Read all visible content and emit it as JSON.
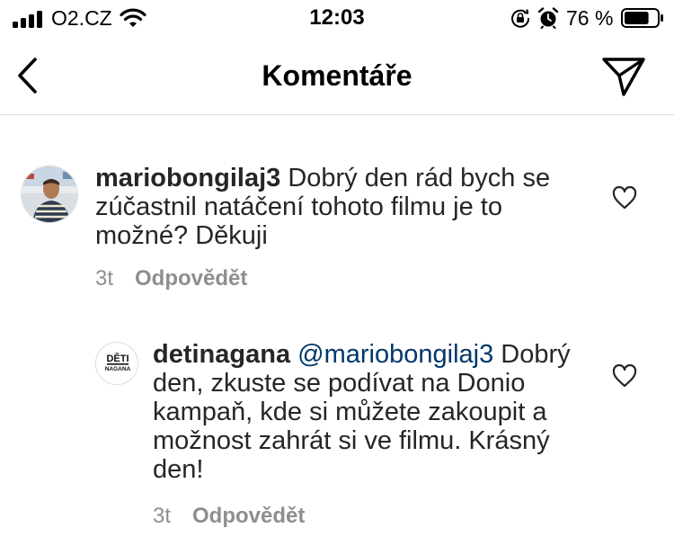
{
  "status_bar": {
    "carrier": "O2.CZ",
    "time": "12:03",
    "battery_percent": "76 %",
    "battery_level": 0.76
  },
  "nav": {
    "title": "Komentáře"
  },
  "comments": [
    {
      "username": "mariobongilaj3",
      "mention": "",
      "text": "Dobrý den rád bych se zúčastnil natáčení tohoto filmu je to možné? Děkuji",
      "age": "3t",
      "reply_label": "Odpovědět"
    },
    {
      "username": "detinagana",
      "avatar_text_top": "DĚTI",
      "avatar_text_bottom": "NAGANA",
      "mention": "@mariobongilaj3",
      "text": "Dobrý den, zkuste se podívat na Donio kampaň, kde si můžete zakoupit a možnost zahrát si ve filmu. Krásný den!",
      "age": "3t",
      "reply_label": "Odpovědět"
    }
  ]
}
